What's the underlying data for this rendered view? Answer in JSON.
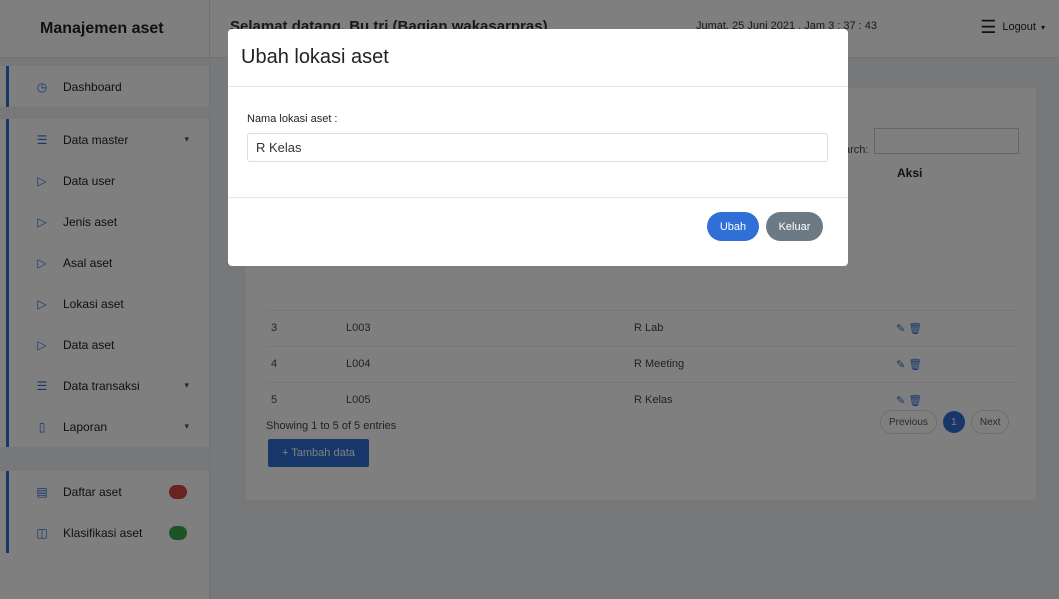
{
  "app": {
    "brand": "Manajemen aset",
    "welcome": "Selamat datang, Bu tri (Bagian wakasarpras)",
    "datetime": "Jumat, 25 Juni 2021 , Jam 3 : 37 : 43",
    "logout_label": "Logout"
  },
  "sidebar": {
    "items": [
      {
        "label": "Dashboard",
        "icon": "dashboard-icon"
      },
      {
        "label": "Data master",
        "icon": "list-icon",
        "caret": "▾"
      },
      {
        "label": "Data user",
        "icon": "play-icon"
      },
      {
        "label": "Jenis aset",
        "icon": "play-icon"
      },
      {
        "label": "Asal aset",
        "icon": "play-icon"
      },
      {
        "label": "Lokasi aset",
        "icon": "play-icon"
      },
      {
        "label": "Data aset",
        "icon": "play-icon"
      },
      {
        "label": "Data transaksi",
        "icon": "list-icon",
        "caret": "▾"
      },
      {
        "label": "Laporan",
        "icon": "file-icon",
        "caret": "▾"
      },
      {
        "label": "Daftar aset",
        "icon": "clipboard-icon",
        "badge_color": "#d64545"
      },
      {
        "label": "Klasifikasi aset",
        "icon": "layout-icon",
        "badge_color": "#3aa84c"
      }
    ]
  },
  "table": {
    "search_label": "arch:",
    "headers": {
      "action": "Aksi"
    },
    "rows": [
      {
        "no": "3",
        "code": "L003",
        "name": "R Lab"
      },
      {
        "no": "4",
        "code": "L004",
        "name": "R Meeting"
      },
      {
        "no": "5",
        "code": "L005",
        "name": "R Kelas"
      }
    ],
    "showing": "Showing 1 to 5 of 5 entries",
    "add_label": "+ Tambah data",
    "pager": {
      "prev": "Previous",
      "current": "1",
      "next": "Next"
    }
  },
  "modal": {
    "title": "Ubah lokasi aset",
    "field_label": "Nama lokasi aset :",
    "field_value": "R Kelas",
    "submit_label": "Ubah",
    "close_label": "Keluar"
  },
  "colors": {
    "accent": "#2f6fd6",
    "secondary": "#6c7a85",
    "overlay": "rgba(0,0,0,0.5)"
  }
}
